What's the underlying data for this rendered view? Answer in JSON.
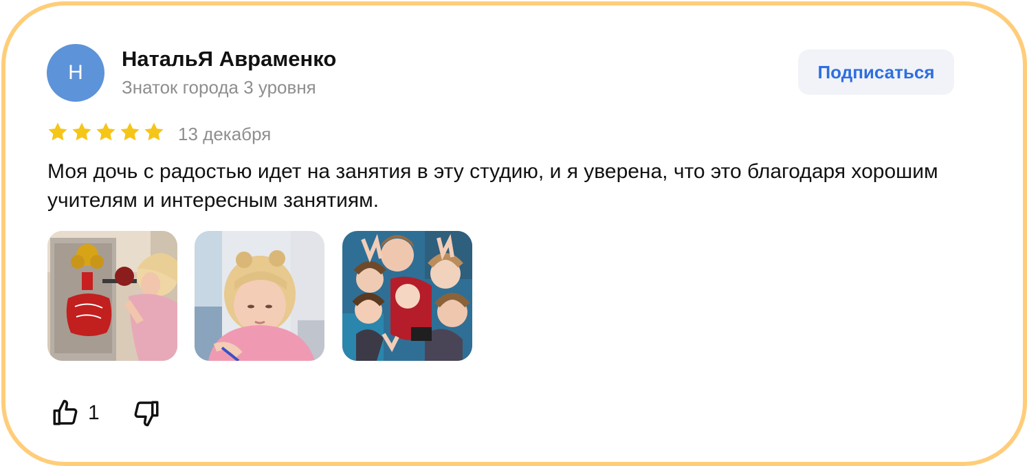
{
  "author": {
    "initial": "Н",
    "name": "НатальЯ Авраменко",
    "level": "Знаток города 3 уровня"
  },
  "subscribe_label": "Подписаться",
  "review": {
    "rating": 5,
    "max_rating": 5,
    "date": "13 декабря",
    "text": "Моя дочь с радостью идет на занятия в эту студию, и я уверена, что это благодаря хорошим учителям и интересным занятиям."
  },
  "photos": [
    {
      "icon": "photo-girl-with-christmas-mailbox"
    },
    {
      "icon": "photo-girl-drawing"
    },
    {
      "icon": "photo-group-of-children"
    }
  ],
  "reactions": {
    "like_count": "1",
    "like_icon": "thumbs-up-icon",
    "dislike_icon": "thumbs-down-icon"
  },
  "colors": {
    "frame_border": "#ffcd7a",
    "avatar_bg": "#5d93d8",
    "star": "#f5c518",
    "accent_link": "#2e6ee0",
    "muted_text": "#8e8e8e"
  }
}
